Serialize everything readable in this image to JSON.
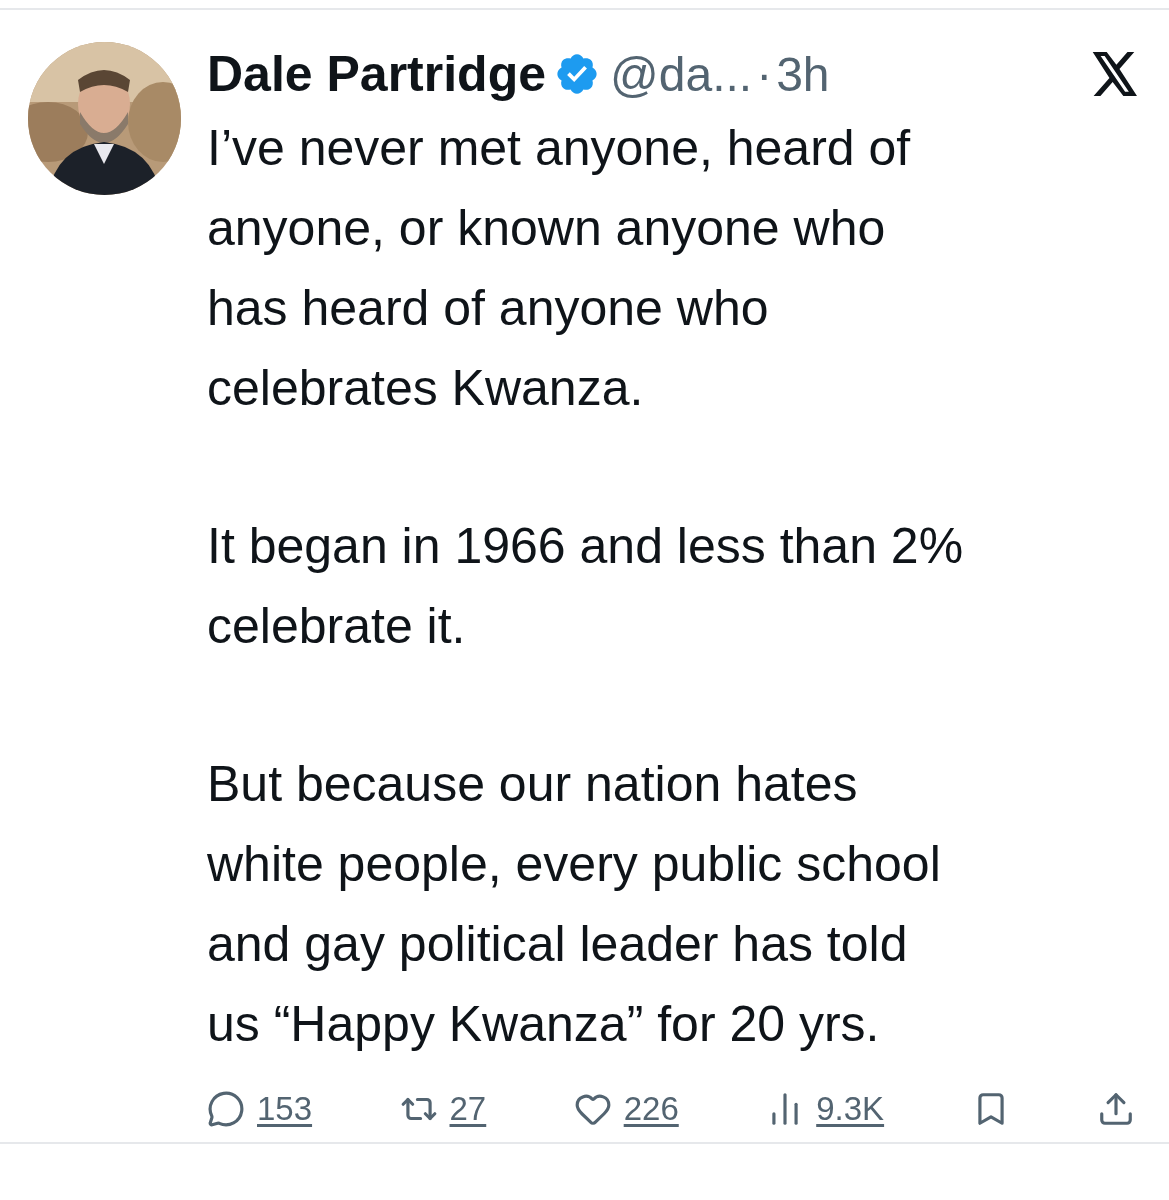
{
  "author": {
    "name": "Dale Partridge",
    "verified": true,
    "handle": "@da...",
    "separator": "·",
    "time": "3h"
  },
  "body": [
    "I’ve never met anyone, heard of\nanyone, or known anyone who\nhas heard of anyone who\ncelebrates Kwanza.",
    "It began in 1966 and less than 2%\ncelebrate it.",
    "But because our nation hates\nwhite people, every public school\nand gay political leader has told\nus “Happy Kwanza” for 20 yrs."
  ],
  "actions": [
    {
      "kind": "reply",
      "count": "153"
    },
    {
      "kind": "repost",
      "count": "27"
    },
    {
      "kind": "like",
      "count": "226"
    },
    {
      "kind": "views",
      "count": "9.3K"
    },
    {
      "kind": "bookmark"
    },
    {
      "kind": "share"
    }
  ]
}
